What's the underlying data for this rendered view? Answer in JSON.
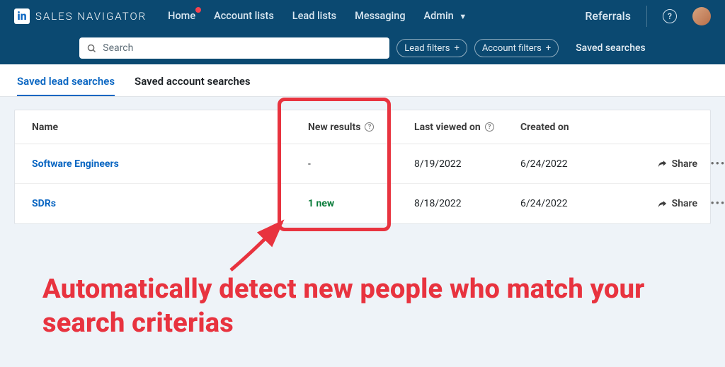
{
  "brand": {
    "logo_text": "in",
    "product": "SALES NAVIGATOR"
  },
  "nav": {
    "home": "Home",
    "account_lists": "Account lists",
    "lead_lists": "Lead lists",
    "messaging": "Messaging",
    "admin": "Admin",
    "referrals": "Referrals"
  },
  "search": {
    "placeholder": "Search",
    "lead_filters": "Lead filters",
    "account_filters": "Account filters",
    "saved_searches": "Saved searches"
  },
  "tabs": {
    "lead": "Saved lead searches",
    "account": "Saved account searches"
  },
  "table": {
    "headers": {
      "name": "Name",
      "new_results": "New results",
      "last_viewed": "Last viewed on",
      "created": "Created on"
    },
    "share_label": "Share",
    "rows": [
      {
        "name": "Software Engineers",
        "new_results": "-",
        "last_viewed": "8/19/2022",
        "created": "6/24/2022"
      },
      {
        "name": "SDRs",
        "new_results": "1 new",
        "last_viewed": "8/18/2022",
        "created": "6/24/2022"
      }
    ]
  },
  "annotation": {
    "caption": "Automatically detect new people who match your search criterias"
  }
}
